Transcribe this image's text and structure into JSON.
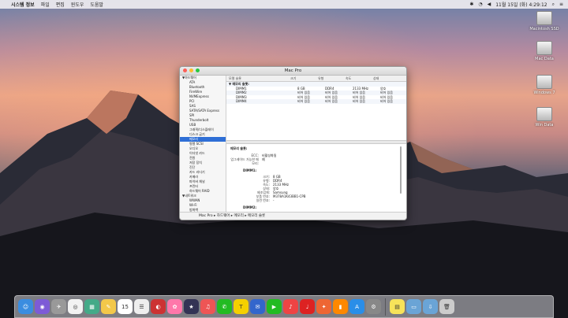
{
  "menubar": {
    "app_name": "시스템 정보",
    "items": [
      "파일",
      "편집",
      "윈도우",
      "도움말"
    ],
    "clock": "11월 15일 (화) 4:29:12"
  },
  "desktop": {
    "icons": [
      "Macintosh SSD",
      "Mac Data",
      "Windows 7",
      "Win Data"
    ]
  },
  "window": {
    "title": "Mac Pro",
    "sidebar": [
      {
        "label": "▼하드웨어",
        "group": true
      },
      {
        "label": "ATA"
      },
      {
        "label": "Bluetooth"
      },
      {
        "label": "FireWire"
      },
      {
        "label": "NVMExpress"
      },
      {
        "label": "PCI"
      },
      {
        "label": "SAS"
      },
      {
        "label": "SATA/SATA Express"
      },
      {
        "label": "SPI"
      },
      {
        "label": "Thunderbolt"
      },
      {
        "label": "USB"
      },
      {
        "label": "그래픽/디스플레이"
      },
      {
        "label": "디스크 굽기"
      },
      {
        "label": "메모리",
        "selected": true
      },
      {
        "label": "병렬 SCSI"
      },
      {
        "label": "오디오"
      },
      {
        "label": "이더넷 카드"
      },
      {
        "label": "전원"
      },
      {
        "label": "저장 장치"
      },
      {
        "label": "진단"
      },
      {
        "label": "카드 리더기"
      },
      {
        "label": "카메라"
      },
      {
        "label": "파이버 채널"
      },
      {
        "label": "프린터"
      },
      {
        "label": "하드웨어 RAID"
      },
      {
        "label": "▼네트워크",
        "group": true
      },
      {
        "label": "WWAN"
      },
      {
        "label": "Wi-Fi"
      },
      {
        "label": "방화벽"
      },
      {
        "label": "볼륨"
      }
    ],
    "columns": [
      "모델 슬롯",
      "크기",
      "유형",
      "속도",
      "상태"
    ],
    "group_label": "▼ 메모리 슬롯:",
    "rows": [
      [
        "DIMM1",
        "8 GB",
        "DDR4",
        "2133 MHz",
        "양호"
      ],
      [
        "DIMM2",
        "비어 있음",
        "비어 있음",
        "비어 있음",
        "비어 있음"
      ],
      [
        "DIMM3",
        "비어 있음",
        "비어 있음",
        "비어 있음",
        "비어 있음"
      ],
      [
        "DIMM4",
        "비어 있음",
        "비어 있음",
        "비어 있음",
        "비어 있음"
      ]
    ],
    "detail": {
      "heading": "메모리 슬롯:",
      "ecc_key": "ECC:",
      "ecc_val": "비활성화됨",
      "upgrade_key": "업그레이드 가능한 메모리:",
      "upgrade_val": "예",
      "dimm1": "DIMM1:",
      "dimm1_kv": [
        [
          "크기:",
          "8 GB"
        ],
        [
          "유형:",
          "DDR4"
        ],
        [
          "속도:",
          "2133 MHz"
        ],
        [
          "상태:",
          "양호"
        ],
        [
          "제조업체:",
          "Samsung"
        ],
        [
          "부품 번호:",
          "M378A1K43BB1-CPB"
        ],
        [
          "일련 번호:",
          "-"
        ]
      ],
      "dimm2": "DIMM2:",
      "dimm2_kv": [
        [
          "크기:",
          "비어 있음"
        ],
        [
          "유형:",
          "비어 있음"
        ],
        [
          "속도:",
          "비어 있음"
        ]
      ]
    },
    "breadcrumb": "Mac Pro  ▸ 하드웨어  ▸ 메모리  ▸ 메모리 슬롯"
  },
  "dock_icons": [
    "finder-icon",
    "siri-icon",
    "launchpad-icon",
    "chrome-icon",
    "preview-icon",
    "notes-icon",
    "calendar-icon",
    "reminders-icon",
    "photo-booth-icon",
    "photos-icon",
    "imovie-icon",
    "ituns-icon",
    "facetime-icon",
    "kakaotalk-icon",
    "messages-icon",
    "facetime-video-icon",
    "music-icon",
    "netease-icon",
    "game-icon",
    "ibooks-icon",
    "appstore-icon",
    "system-prefs-icon",
    "stickies-icon",
    "folder-icon",
    "downloads-icon",
    "trash-icon"
  ]
}
